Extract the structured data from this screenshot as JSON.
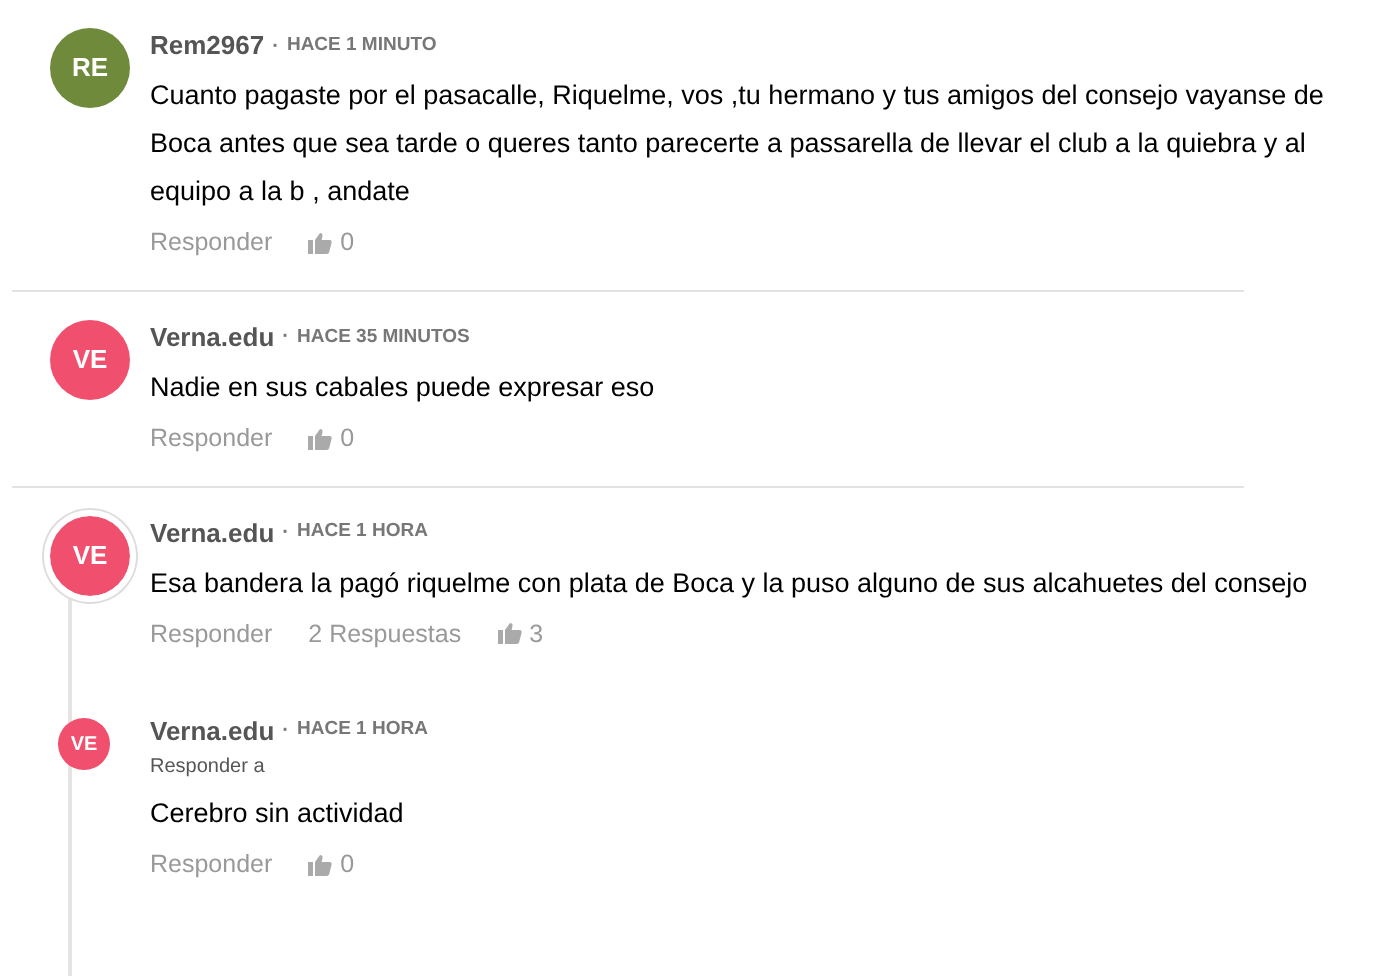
{
  "separator": "·",
  "comments": [
    {
      "initials": "RE",
      "color": "#6f8a3a",
      "author": "Rem2967",
      "time": "HACE 1 MINUTO",
      "text": "Cuanto pagaste por el pasacalle, Riquelme, vos ,tu hermano y tus amigos del consejo vayanse de Boca antes que sea tarde o queres tanto parecerte a passarella de llevar el club a la quiebra y al equipo a la b , andate",
      "reply": "Responder",
      "likes": "0"
    },
    {
      "initials": "VE",
      "color": "#f0506e",
      "author": "Verna.edu",
      "time": "HACE 35 MINUTOS",
      "text": "Nadie en sus cabales puede expresar eso",
      "reply": "Responder",
      "likes": "0"
    },
    {
      "initials": "VE",
      "color": "#f0506e",
      "author": "Verna.edu",
      "time": "HACE 1 HORA",
      "text": "Esa bandera la pagó riquelme con plata de Boca y la puso alguno de sus alcahuetes del consejo",
      "reply": "Responder",
      "replies_count": "2 Respuestas",
      "likes": "3",
      "children": [
        {
          "initials": "VE",
          "color": "#f0506e",
          "author": "Verna.edu",
          "time": "HACE 1 HORA",
          "reply_to": "Responder a",
          "text": "Cerebro sin actividad",
          "reply": "Responder",
          "likes": "0"
        }
      ]
    }
  ]
}
